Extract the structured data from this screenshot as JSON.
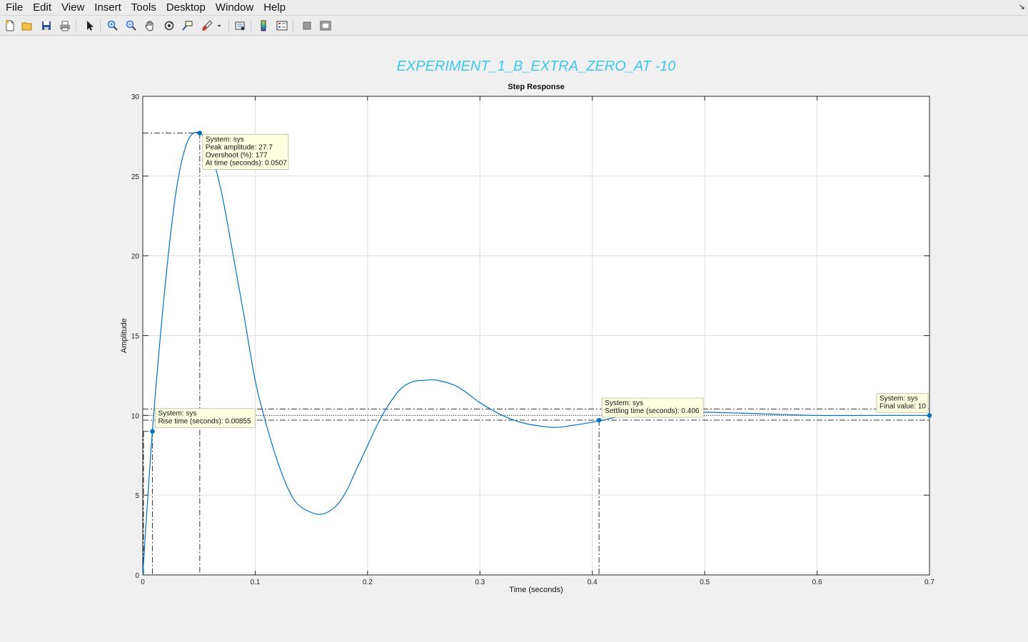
{
  "menubar": {
    "items": [
      "File",
      "Edit",
      "View",
      "Insert",
      "Tools",
      "Desktop",
      "Window",
      "Help"
    ]
  },
  "toolbar": {
    "buttons": [
      {
        "name": "new-figure-icon",
        "color": "#2b6fd6"
      },
      {
        "name": "open-folder-icon",
        "color": "#e0a21b"
      },
      {
        "name": "save-icon",
        "color": "#2f55a4"
      },
      {
        "name": "print-icon",
        "color": "#666666"
      },
      {
        "name": "select-arrow-icon",
        "color": "#222222"
      },
      {
        "name": "zoom-in-icon",
        "color": "#2b6fd6"
      },
      {
        "name": "zoom-out-icon",
        "color": "#2b6fd6"
      },
      {
        "name": "pan-hand-icon",
        "color": "#333333"
      },
      {
        "name": "rotate-3d-icon",
        "color": "#333333"
      },
      {
        "name": "data-cursor-icon",
        "color": "#333333"
      },
      {
        "name": "brush-icon",
        "color": "#c0392b"
      },
      {
        "name": "link-plot-icon",
        "color": "#333333"
      },
      {
        "name": "colorbar-icon",
        "color": "#2b6fd6"
      },
      {
        "name": "legend-icon",
        "color": "#c0392b"
      },
      {
        "name": "hide-plot-tools-icon",
        "color": "#777777"
      },
      {
        "name": "show-plot-tools-icon",
        "color": "#333333"
      }
    ]
  },
  "colors": {
    "suptitle": "#3cc8ee",
    "curve": "#0072bd",
    "axes_bg": "#ffffff",
    "grid": "#dcdcdc",
    "tip_bg": "#ffffe1"
  },
  "chart_data": {
    "type": "line",
    "suptitle": "EXPERIMENT_1_B_EXTRA_ZERO_AT -10",
    "title": "Step Response",
    "xlabel": "Time (seconds)",
    "ylabel": "Amplitude",
    "xlim": [
      0,
      0.7
    ],
    "ylim": [
      0,
      30
    ],
    "xticks": [
      0,
      0.1,
      0.2,
      0.3,
      0.4,
      0.5,
      0.6,
      0.7
    ],
    "xtick_labels": [
      "0",
      "0.1",
      "0.2",
      "0.3",
      "0.4",
      "0.5",
      "0.6",
      "0.7"
    ],
    "yticks": [
      0,
      5,
      10,
      15,
      20,
      25,
      30
    ],
    "ytick_labels": [
      "0",
      "5",
      "10",
      "15",
      "20",
      "25",
      "30"
    ],
    "grid": true,
    "series": [
      {
        "name": "sys",
        "x": [
          0,
          0.00855,
          0.02,
          0.03,
          0.04,
          0.0507,
          0.06,
          0.07,
          0.08,
          0.09,
          0.1,
          0.11,
          0.12,
          0.13,
          0.14,
          0.157,
          0.17,
          0.18,
          0.19,
          0.2,
          0.21,
          0.22,
          0.23,
          0.24,
          0.25,
          0.262,
          0.28,
          0.3,
          0.32,
          0.34,
          0.365,
          0.38,
          0.406,
          0.43,
          0.46,
          0.5,
          0.55,
          0.6,
          0.65,
          0.7
        ],
        "y": [
          0,
          9.0,
          18.2,
          24.2,
          27.2,
          27.7,
          26.6,
          24.0,
          20.2,
          16.3,
          12.2,
          9.4,
          7.1,
          5.3,
          4.3,
          3.8,
          4.2,
          5.1,
          6.6,
          8.1,
          9.6,
          10.8,
          11.7,
          12.1,
          12.2,
          12.2,
          11.8,
          10.8,
          10.0,
          9.5,
          9.25,
          9.35,
          9.65,
          10.0,
          10.2,
          10.2,
          10.1,
          10.0,
          10.0,
          10.0
        ]
      }
    ],
    "reference_lines": {
      "final_value": 10,
      "settling_band": [
        9.7,
        10.4
      ],
      "rise_time_level": 9.0,
      "rise_time": 0.00855,
      "peak_amplitude": 27.7,
      "peak_time": 0.0507,
      "settling_time": 0.406
    },
    "annotations": [
      {
        "id": "peak",
        "x": 0.0507,
        "y": 27.7,
        "lines": [
          "System: sys",
          "Peak amplitude: 27.7",
          "Overshoot (%): 177",
          "At time (seconds): 0.0507"
        ]
      },
      {
        "id": "rise",
        "x": 0.00855,
        "y": 9.0,
        "lines": [
          "System: sys",
          "Rise time (seconds): 0.00855"
        ]
      },
      {
        "id": "settling",
        "x": 0.406,
        "y": 9.7,
        "lines": [
          "System: sys",
          "Settling time (seconds): 0.406"
        ]
      },
      {
        "id": "final",
        "x": 0.7,
        "y": 10,
        "lines": [
          "System: sys",
          "Final value: 10"
        ]
      }
    ]
  }
}
